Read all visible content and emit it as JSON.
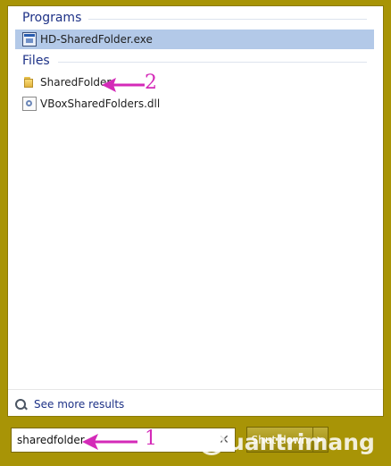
{
  "results": {
    "programs": {
      "header": "Programs",
      "items": [
        {
          "label": "HD-SharedFolder.exe",
          "icon": "exe-icon",
          "selected": true
        }
      ]
    },
    "files": {
      "header": "Files",
      "items": [
        {
          "label": "SharedFolder",
          "icon": "folder-icon"
        },
        {
          "label": "VBoxSharedFolders.dll",
          "icon": "dll-icon"
        }
      ]
    },
    "see_more": "See more results"
  },
  "search": {
    "value": "sharedfolder",
    "clear_icon": "close-icon"
  },
  "shutdown": {
    "label": "Shut down",
    "arrow_icon": "triangle-right-icon"
  },
  "annotations": {
    "one": "1",
    "two": "2",
    "color": "#d42ab8"
  },
  "watermark": {
    "text": "uantrimang",
    "icon": "clock-icon"
  },
  "colors": {
    "background": "#a89406",
    "selection": "#b3c9e8",
    "header_text": "#1e3287"
  }
}
